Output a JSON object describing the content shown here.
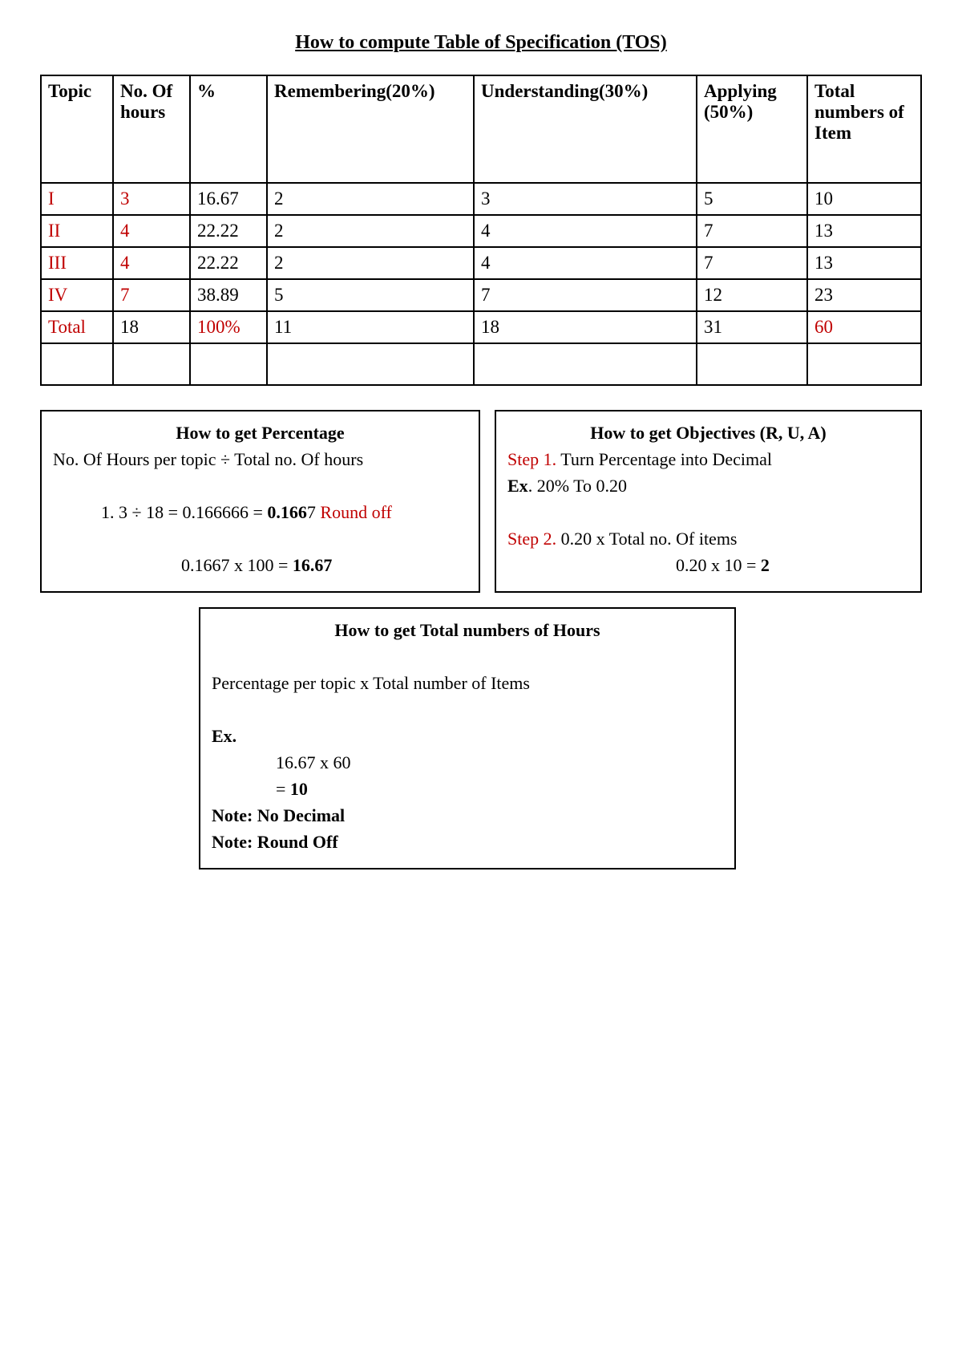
{
  "title": "How to compute Table of Specification (TOS)",
  "headers": {
    "topic": "Topic",
    "hours": "No. Of hours",
    "pct": "%",
    "remembering": "Remembering(20%)",
    "understanding": "Understanding(30%)",
    "applying": "Applying (50%)",
    "total": "Total numbers of Item"
  },
  "rows": [
    {
      "topic": "I",
      "hours": "3",
      "pct": "16.67",
      "r": "2",
      "u": "3",
      "a": "5",
      "total": "10"
    },
    {
      "topic": "II",
      "hours": "4",
      "pct": "22.22",
      "r": "2",
      "u": "4",
      "a": "7",
      "total": "13"
    },
    {
      "topic": "III",
      "hours": "4",
      "pct": "22.22",
      "r": "2",
      "u": "4",
      "a": "7",
      "total": "13"
    },
    {
      "topic": "IV",
      "hours": "7",
      "pct": "38.89",
      "r": "5",
      "u": "7",
      "a": "12",
      "total": "23"
    }
  ],
  "totalRow": {
    "label": "Total",
    "hours": "18",
    "pct": "100%",
    "r": "11",
    "u": "18",
    "a": "31",
    "total": "60"
  },
  "box1": {
    "title": "How to get Percentage",
    "line1": "No. Of Hours per topic ÷ Total no. Of hours",
    "line2a": "1. 3 ÷ 18 = 0.166666 = ",
    "line2b": "0.166",
    "line2c": "7 ",
    "line2d": "Round off",
    "line3a": "0.1667 x 100 = ",
    "line3b": "16.67"
  },
  "box2": {
    "title": "How to get Objectives (R, U, A)",
    "s1a": "Step 1.",
    "s1b": " Turn Percentage into Decimal",
    "exLabel": "Ex",
    "exText": ". 20% To 0.20",
    "s2a": "Step 2.",
    "s2b": " 0.20 x Total no. Of items",
    "s2calc_a": "0.20 x 10 = ",
    "s2calc_b": "2"
  },
  "box3": {
    "title": "How to get Total numbers of Hours",
    "line1": "Percentage per topic x Total number of Items",
    "exLabel": "Ex.",
    "calc1": "16.67 x 60",
    "calc2a": "= ",
    "calc2b": "10",
    "note1": "Note: No Decimal",
    "note2": "Note: Round Off"
  }
}
